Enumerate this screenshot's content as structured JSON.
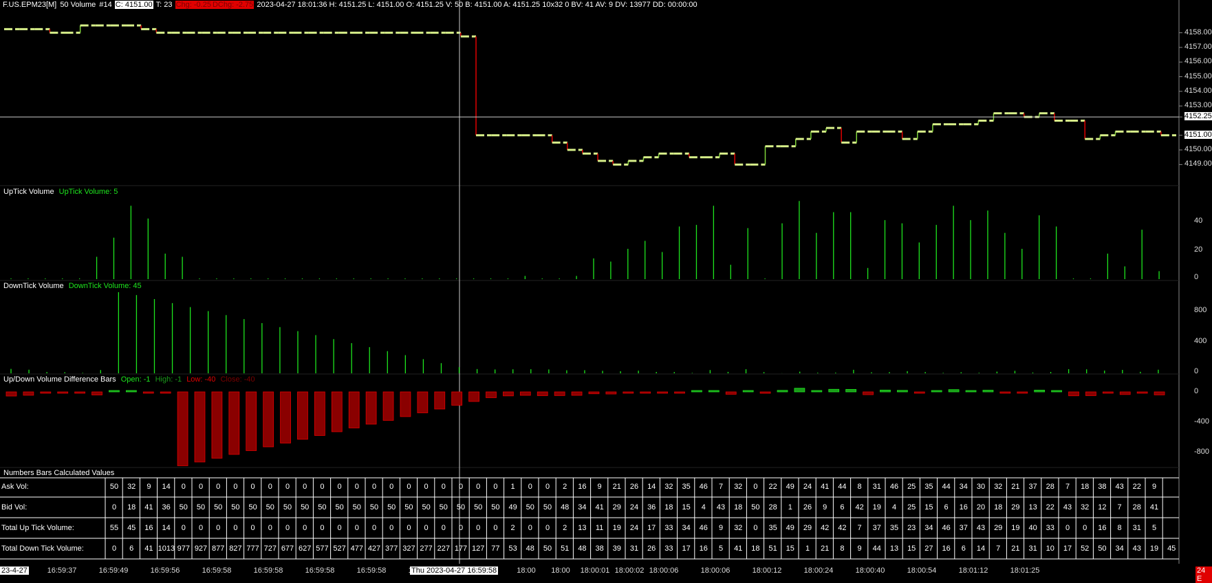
{
  "header": {
    "symbol": "F.US.EPM23[M]",
    "bar_type": "50 Volume",
    "chart_num": "#14",
    "close": "C: 4151.00",
    "ticks": "T: 23",
    "chg": "Chg: -0.25",
    "dchg": "DChg: -2.75",
    "info": "2023-04-27 18:01:36 H: 4151.25 L: 4151.00 O: 4151.25 V: 50 B: 4151.00 A: 4151.25 10x32 0 BV: 41 AV: 9 DV: 13977 DD: 00:00:00"
  },
  "price_axis": {
    "labels": [
      "4158.00",
      "4157.00",
      "4156.00",
      "4155.00",
      "4154.00",
      "4153.00",
      "4152.25",
      "4151.00",
      "4150.00",
      "4149.00"
    ],
    "crosshair_value": "4152.25",
    "last_value": "4151.00"
  },
  "uptick_panel": {
    "title": "UpTick Volume",
    "value_label": "UpTick Volume: 5",
    "axis": [
      "40",
      "20",
      "0"
    ]
  },
  "downtick_panel": {
    "title": "DownTick Volume",
    "value_label": "DownTick Volume: 45",
    "axis": [
      "800",
      "400",
      "0"
    ]
  },
  "diff_panel": {
    "title": "Up/Down Volume Difference Bars",
    "open": "Open: -1",
    "high": "High: -1",
    "low": "Low: -40",
    "close": "Close: -40",
    "axis": [
      "0",
      "-400",
      "-800"
    ]
  },
  "numbers_title": "Numbers Bars Calculated Values",
  "table": {
    "rows": [
      {
        "label": "Ask Vol:",
        "values": [
          "50",
          "32",
          "9",
          "14",
          "0",
          "0",
          "0",
          "0",
          "0",
          "0",
          "0",
          "0",
          "0",
          "0",
          "0",
          "0",
          "0",
          "0",
          "0",
          "0",
          "0",
          "0",
          "0",
          "1",
          "0",
          "0",
          "2",
          "16",
          "9",
          "21",
          "26",
          "14",
          "32",
          "35",
          "46",
          "7",
          "32",
          "0",
          "22",
          "49",
          "24",
          "41",
          "44",
          "8",
          "31",
          "46",
          "25",
          "35",
          "44",
          "34",
          "30",
          "32",
          "21",
          "37",
          "28",
          "7",
          "18",
          "38",
          "43",
          "22",
          "9"
        ]
      },
      {
        "label": "Bid Vol:",
        "values": [
          "0",
          "18",
          "41",
          "36",
          "50",
          "50",
          "50",
          "50",
          "50",
          "50",
          "50",
          "50",
          "50",
          "50",
          "50",
          "50",
          "50",
          "50",
          "50",
          "50",
          "50",
          "50",
          "50",
          "49",
          "50",
          "50",
          "48",
          "34",
          "41",
          "29",
          "24",
          "36",
          "18",
          "15",
          "4",
          "43",
          "18",
          "50",
          "28",
          "1",
          "26",
          "9",
          "6",
          "42",
          "19",
          "4",
          "25",
          "15",
          "6",
          "16",
          "20",
          "18",
          "29",
          "13",
          "22",
          "43",
          "32",
          "12",
          "7",
          "28",
          "41"
        ]
      },
      {
        "label": "Total Up Tick Volume:",
        "values": [
          "55",
          "45",
          "16",
          "14",
          "0",
          "0",
          "0",
          "0",
          "0",
          "0",
          "0",
          "0",
          "0",
          "0",
          "0",
          "0",
          "0",
          "0",
          "0",
          "0",
          "0",
          "0",
          "0",
          "2",
          "0",
          "0",
          "2",
          "13",
          "11",
          "19",
          "24",
          "17",
          "33",
          "34",
          "46",
          "9",
          "32",
          "0",
          "35",
          "49",
          "29",
          "42",
          "42",
          "7",
          "37",
          "35",
          "23",
          "34",
          "46",
          "37",
          "43",
          "29",
          "19",
          "40",
          "33",
          "0",
          "0",
          "16",
          "8",
          "31",
          "5"
        ]
      },
      {
        "label": "Total Down Tick Volume:",
        "values": [
          "0",
          "6",
          "41",
          "1013",
          "977",
          "927",
          "877",
          "827",
          "777",
          "727",
          "677",
          "627",
          "577",
          "527",
          "477",
          "427",
          "377",
          "327",
          "277",
          "227",
          "177",
          "127",
          "77",
          "53",
          "48",
          "50",
          "51",
          "48",
          "38",
          "39",
          "31",
          "26",
          "33",
          "17",
          "16",
          "5",
          "41",
          "18",
          "51",
          "15",
          "1",
          "21",
          "8",
          "9",
          "44",
          "13",
          "15",
          "27",
          "16",
          "6",
          "14",
          "7",
          "21",
          "31",
          "10",
          "17",
          "52",
          "50",
          "34",
          "43",
          "19",
          "45"
        ]
      }
    ]
  },
  "time_axis": {
    "ticks": [
      "16:59:37",
      "16:59:49",
      "16:59:56",
      "16:59:58",
      "16:59:58",
      "16:59:58",
      "16:59:58",
      "16:59:58",
      "18:00",
      "18:00",
      "18:00",
      "18:00:01",
      "18:00:02",
      "18:00:06",
      "18:00:06",
      "18:00:12",
      "18:00:24",
      "18:00:40",
      "18:00:54",
      "18:01:12",
      "18:01:25"
    ],
    "left_date": "23-4-27",
    "crosshair_date": "Thu 2023-04-27  16:59:58",
    "right_tag": "24 E"
  },
  "chart_data": {
    "type": "bar",
    "title": "F.US.EPM23[M] 50 Volume",
    "price_levels": [
      4158.25,
      4158.25,
      4158.25,
      4158.0,
      4158.0,
      4158.5,
      4158.5,
      4158.5,
      4158.5,
      4158.25,
      4158.0,
      4158.0,
      4158.0,
      4158.0,
      4158.0,
      4158.0,
      4158.0,
      4158.0,
      4158.0,
      4158.0,
      4158.0,
      4158.0,
      4158.0,
      4158.0,
      4158.0,
      4158.0,
      4158.0,
      4158.0,
      4158.0,
      4158.0,
      4157.75,
      4151.0,
      4151.0,
      4151.0,
      4151.0,
      4151.0,
      4150.5,
      4150.0,
      4149.75,
      4149.25,
      4149.0,
      4149.25,
      4149.5,
      4149.75,
      4149.75,
      4149.5,
      4149.5,
      4149.75,
      4149.0,
      4149.0,
      4150.25,
      4150.25,
      4150.75,
      4151.25,
      4151.5,
      4150.5,
      4151.25,
      4151.25,
      4151.25,
      4150.75,
      4151.25,
      4151.75,
      4151.75,
      4151.75,
      4152.0,
      4152.5,
      4152.5,
      4152.25,
      4152.5,
      4152.0,
      4152.0,
      4150.75,
      4151.0,
      4151.25,
      4151.25,
      4151.25,
      4151.0
    ],
    "uptick_volume": [
      0,
      0,
      0,
      0,
      0,
      14,
      26,
      46,
      38,
      16,
      14,
      0,
      0,
      0,
      0,
      0,
      0,
      0,
      0,
      0,
      0,
      0,
      0,
      0,
      0,
      0,
      0,
      0,
      0,
      0,
      2,
      0,
      0,
      2,
      13,
      11,
      19,
      24,
      17,
      33,
      34,
      46,
      9,
      32,
      0,
      35,
      49,
      29,
      42,
      42,
      7,
      37,
      35,
      23,
      34,
      46,
      37,
      43,
      29,
      19,
      40,
      33,
      0,
      0,
      16,
      8,
      31,
      5
    ],
    "downtick_volume": [
      55,
      45,
      16,
      14,
      6,
      41,
      1013,
      977,
      927,
      877,
      827,
      777,
      727,
      677,
      627,
      577,
      527,
      477,
      427,
      377,
      327,
      277,
      227,
      177,
      127,
      77,
      53,
      48,
      50,
      51,
      48,
      38,
      39,
      31,
      26,
      33,
      17,
      16,
      5,
      41,
      18,
      51,
      15,
      1,
      21,
      8,
      9,
      44,
      13,
      15,
      27,
      16,
      6,
      14,
      7,
      21,
      31,
      10,
      17,
      52,
      50,
      34,
      43,
      19,
      45
    ],
    "diff_values": [
      -55,
      -45,
      -16,
      -14,
      -6,
      -41,
      1,
      1,
      -3,
      -1,
      -977,
      -927,
      -877,
      -827,
      -777,
      -727,
      -677,
      -627,
      -577,
      -527,
      -477,
      -427,
      -377,
      -327,
      -277,
      -227,
      -177,
      -127,
      -77,
      -53,
      -46,
      -50,
      -49,
      -46,
      -25,
      -28,
      -12,
      -7,
      -9,
      -16,
      17,
      18,
      -32,
      14,
      -19,
      20,
      48,
      8,
      34,
      33,
      -37,
      24,
      20,
      -4,
      18,
      30,
      6,
      22,
      -2,
      -12,
      23,
      16,
      -52,
      -50,
      -18,
      -35,
      -12,
      -40
    ]
  }
}
